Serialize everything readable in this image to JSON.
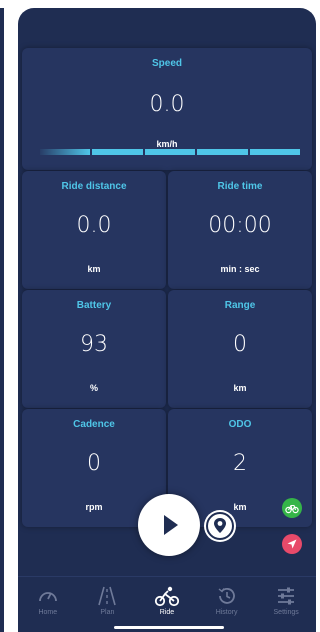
{
  "speed": {
    "label": "Speed",
    "value": "0.0",
    "unit": "km/h"
  },
  "tiles": [
    {
      "label": "Ride distance",
      "value": "0.0",
      "unit": "km"
    },
    {
      "label": "Ride time",
      "value": "00:00",
      "unit": "min : sec"
    },
    {
      "label": "Battery",
      "value": "93",
      "unit": "%"
    },
    {
      "label": "Range",
      "value": "0",
      "unit": "km"
    },
    {
      "label": "Cadence",
      "value": "0",
      "unit": "rpm"
    },
    {
      "label": "ODO",
      "value": "2",
      "unit": "km"
    }
  ],
  "nav": [
    {
      "label": "Home",
      "icon": "gauge-icon"
    },
    {
      "label": "Plan",
      "icon": "road-icon"
    },
    {
      "label": "Ride",
      "icon": "bicycle-icon",
      "active": true
    },
    {
      "label": "History",
      "icon": "history-icon"
    },
    {
      "label": "Settings",
      "icon": "sliders-icon"
    }
  ],
  "colors": {
    "accent": "#4fc6e8",
    "background": "#1f2d52",
    "tile": "#263560",
    "green": "#35b548",
    "red": "#e84a6a"
  }
}
